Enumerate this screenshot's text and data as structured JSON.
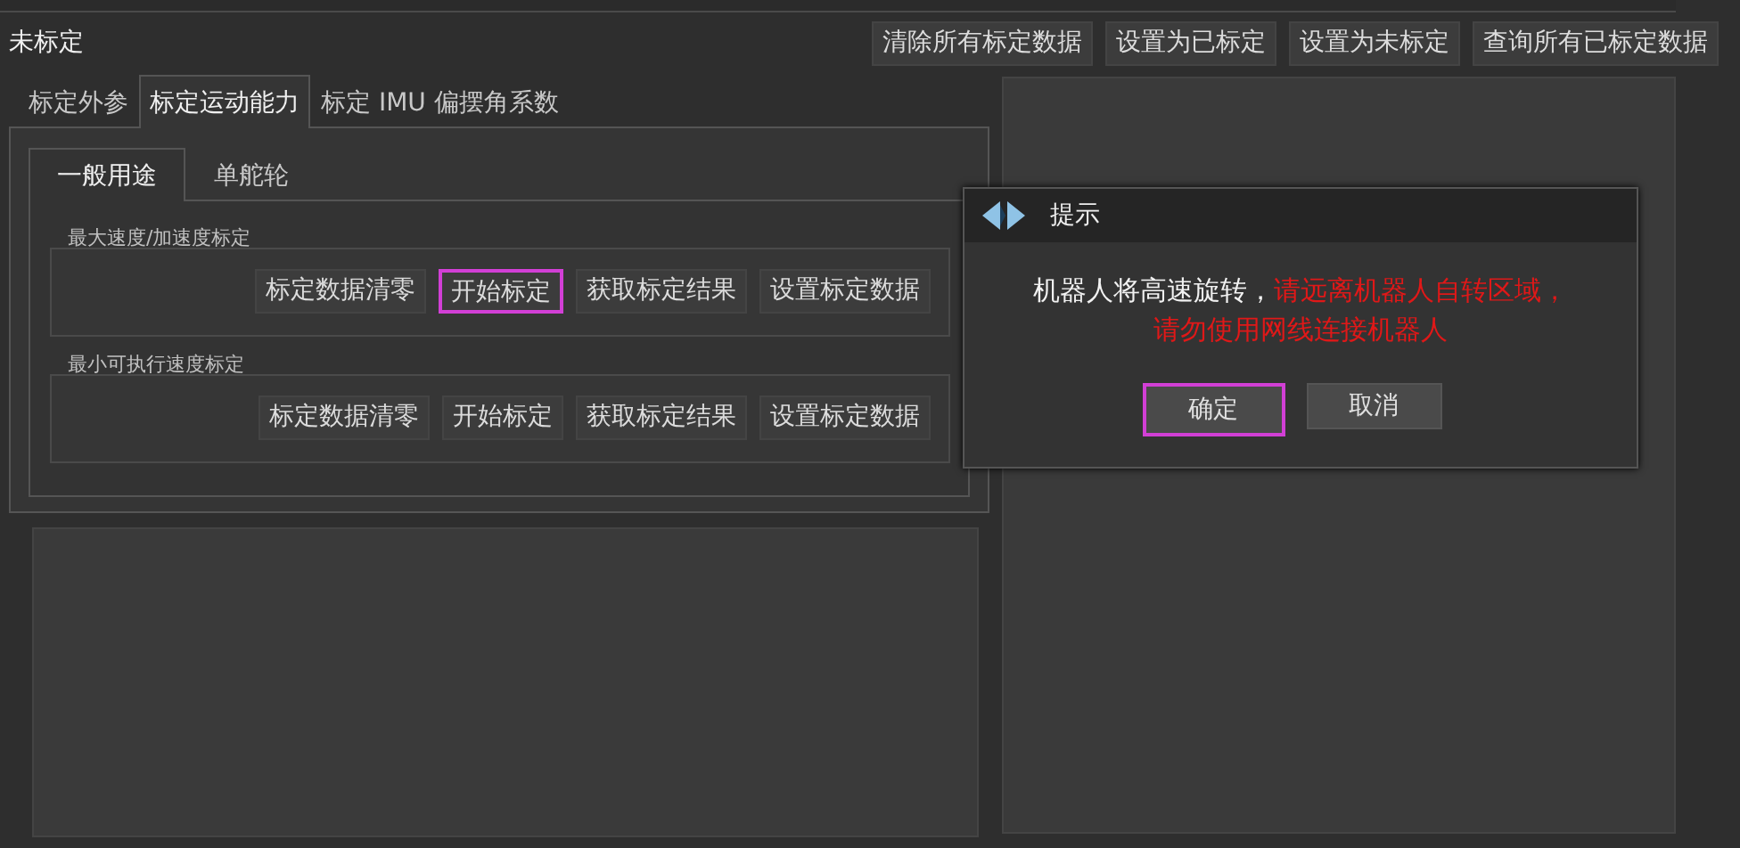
{
  "status": "未标定",
  "top_buttons": [
    "清除所有标定数据",
    "设置为已标定",
    "设置为未标定",
    "查询所有已标定数据"
  ],
  "tabs": [
    {
      "label": "标定外参",
      "selected": false
    },
    {
      "label": "标定运动能力",
      "selected": true
    },
    {
      "label": "标定 IMU 偏摆角系数",
      "selected": false
    }
  ],
  "subtabs": [
    {
      "label": "一般用途",
      "selected": true
    },
    {
      "label": "单舵轮",
      "selected": false
    }
  ],
  "groups": [
    {
      "title": "最大速度/加速度标定",
      "buttons": [
        {
          "label": "标定数据清零",
          "highlighted": false
        },
        {
          "label": "开始标定",
          "highlighted": true
        },
        {
          "label": "获取标定结果",
          "highlighted": false
        },
        {
          "label": "设置标定数据",
          "highlighted": false
        }
      ]
    },
    {
      "title": "最小可执行速度标定",
      "buttons": [
        {
          "label": "标定数据清零",
          "highlighted": false
        },
        {
          "label": "开始标定",
          "highlighted": false
        },
        {
          "label": "获取标定结果",
          "highlighted": false
        },
        {
          "label": "设置标定数据",
          "highlighted": false
        }
      ]
    }
  ],
  "dialog": {
    "title": "提示",
    "message": "机器人将高速旋转，",
    "warning": "请远离机器人自转区域，请勿使用网线连接机器人",
    "buttons": [
      {
        "label": "确定",
        "highlighted": true
      },
      {
        "label": "取消",
        "highlighted": false
      }
    ]
  }
}
